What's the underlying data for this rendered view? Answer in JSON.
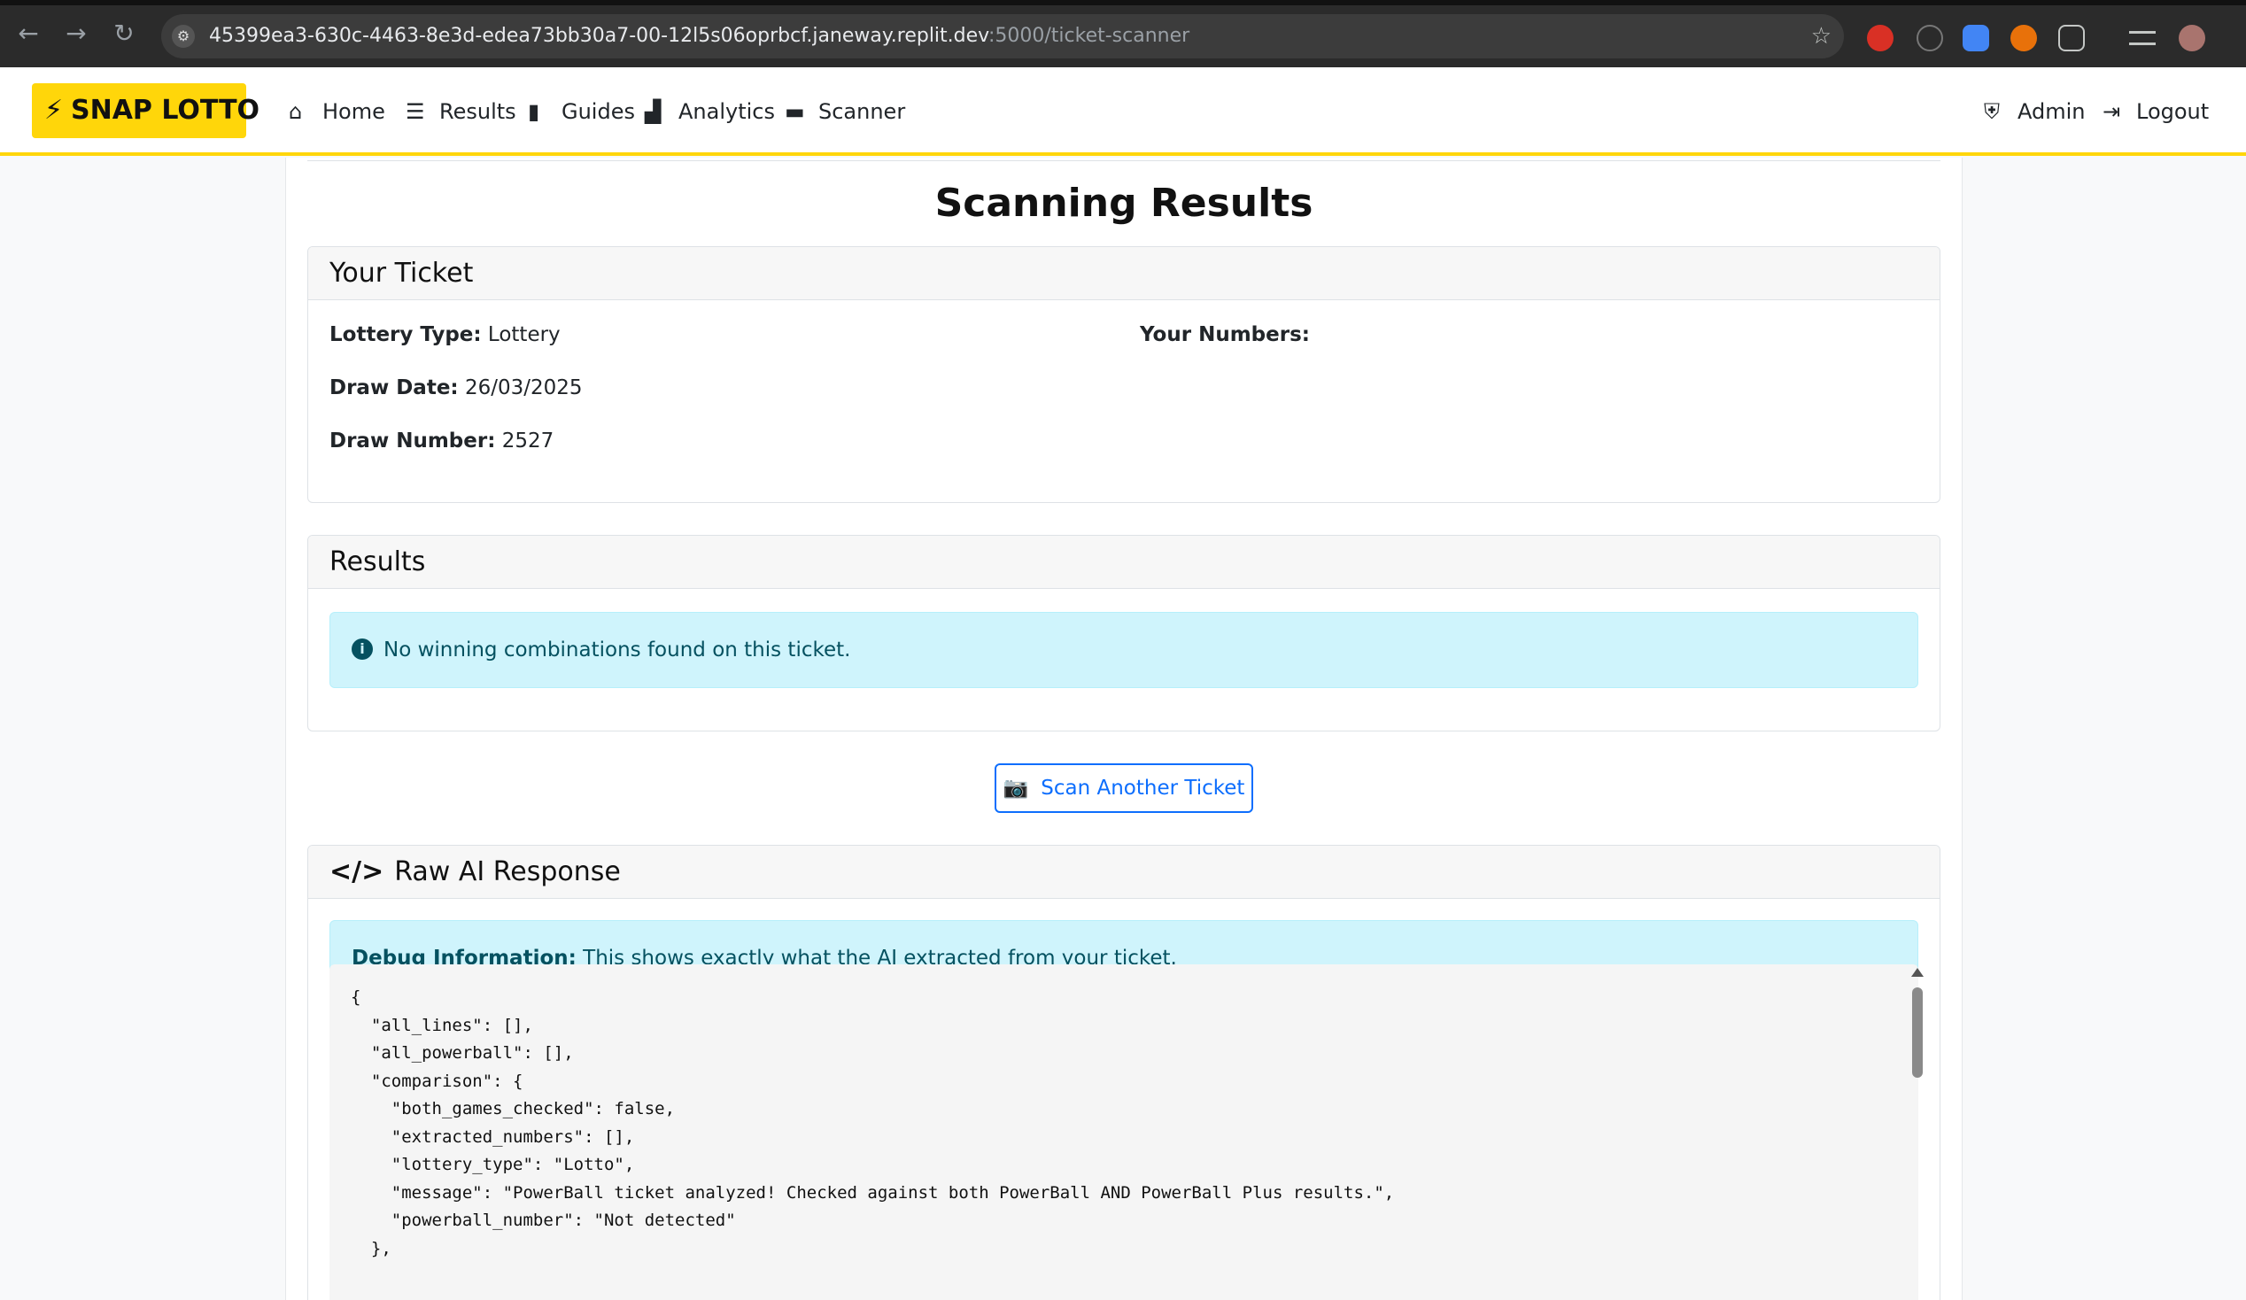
{
  "browser": {
    "url_host": "45399ea3-630c-4463-8e3d-edea73bb30a7-00-12l5s06oprbcf.janeway.replit.dev",
    "url_path": ":5000/ticket-scanner"
  },
  "nav": {
    "brand": "SNAP LOTTO",
    "items": [
      {
        "label": "Home",
        "icon": "home-icon"
      },
      {
        "label": "Results",
        "icon": "list-icon"
      },
      {
        "label": "Guides",
        "icon": "book-icon"
      },
      {
        "label": "Analytics",
        "icon": "chart-icon"
      },
      {
        "label": "Scanner",
        "icon": "ticket-icon"
      }
    ],
    "right": [
      {
        "label": "Admin",
        "icon": "shield-icon"
      },
      {
        "label": "Logout",
        "icon": "logout-icon"
      }
    ]
  },
  "page": {
    "title": "Scanning Results"
  },
  "ticket": {
    "header": "Your Ticket",
    "lottery_type_label": "Lottery Type:",
    "lottery_type": "Lottery",
    "draw_date_label": "Draw Date:",
    "draw_date": "26/03/2025",
    "draw_number_label": "Draw Number:",
    "draw_number": "2527",
    "numbers_label": "Your Numbers:"
  },
  "results": {
    "header": "Results",
    "message": "No winning combinations found on this ticket."
  },
  "scan_button": "Scan Another Ticket",
  "raw": {
    "header": "Raw AI Response",
    "debug_label": "Debug Information:",
    "debug_text": "This shows exactly what the AI extracted from your ticket.",
    "json_text": "{\n  \"all_lines\": [],\n  \"all_powerball\": [],\n  \"comparison\": {\n    \"both_games_checked\": false,\n    \"extracted_numbers\": [],\n    \"lottery_type\": \"Lotto\",\n    \"message\": \"PowerBall ticket analyzed! Checked against both PowerBall AND PowerBall Plus results.\",\n    \"powerball_number\": \"Not detected\"\n  },"
  },
  "colors": {
    "brand_yellow": "#ffd60a",
    "primary_blue": "#0d6efd",
    "info_bg": "#cff4fc",
    "info_text": "#055160"
  }
}
